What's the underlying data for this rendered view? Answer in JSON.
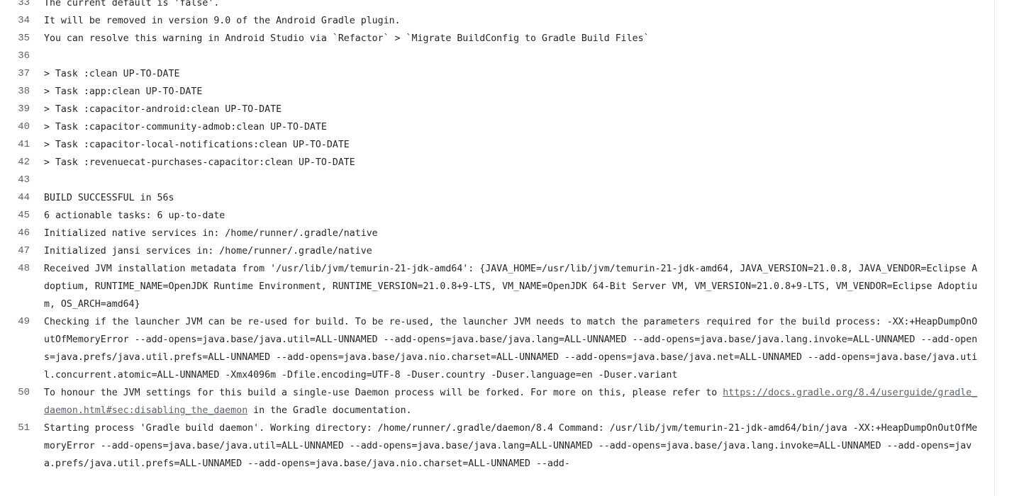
{
  "log": {
    "lines": [
      {
        "n": "33",
        "text": "The current default is 'false'."
      },
      {
        "n": "34",
        "text": "It will be removed in version 9.0 of the Android Gradle plugin."
      },
      {
        "n": "35",
        "text": "You can resolve this warning in Android Studio via `Refactor` > `Migrate BuildConfig to Gradle Build Files`"
      },
      {
        "n": "36",
        "text": ""
      },
      {
        "n": "37",
        "text": "> Task :clean UP-TO-DATE"
      },
      {
        "n": "38",
        "text": "> Task :app:clean UP-TO-DATE"
      },
      {
        "n": "39",
        "text": "> Task :capacitor-android:clean UP-TO-DATE"
      },
      {
        "n": "40",
        "text": "> Task :capacitor-community-admob:clean UP-TO-DATE"
      },
      {
        "n": "41",
        "text": "> Task :capacitor-local-notifications:clean UP-TO-DATE"
      },
      {
        "n": "42",
        "text": "> Task :revenuecat-purchases-capacitor:clean UP-TO-DATE"
      },
      {
        "n": "43",
        "text": ""
      },
      {
        "n": "44",
        "text": "BUILD SUCCESSFUL in 56s"
      },
      {
        "n": "45",
        "text": "6 actionable tasks: 6 up-to-date"
      },
      {
        "n": "46",
        "text": "Initialized native services in: /home/runner/.gradle/native"
      },
      {
        "n": "47",
        "text": "Initialized jansi services in: /home/runner/.gradle/native"
      },
      {
        "n": "48",
        "text": "Received JVM installation metadata from '/usr/lib/jvm/temurin-21-jdk-amd64': {JAVA_HOME=/usr/lib/jvm/temurin-21-jdk-amd64, JAVA_VERSION=21.0.8, JAVA_VENDOR=Eclipse Adoptium, RUNTIME_NAME=OpenJDK Runtime Environment, RUNTIME_VERSION=21.0.8+9-LTS, VM_NAME=OpenJDK 64-Bit Server VM, VM_VERSION=21.0.8+9-LTS, VM_VENDOR=Eclipse Adoptium, OS_ARCH=amd64}"
      },
      {
        "n": "49",
        "text": "Checking if the launcher JVM can be re-used for build. To be re-used, the launcher JVM needs to match the parameters required for the build process: -XX:+HeapDumpOnOutOfMemoryError --add-opens=java.base/java.util=ALL-UNNAMED --add-opens=java.base/java.lang=ALL-UNNAMED --add-opens=java.base/java.lang.invoke=ALL-UNNAMED --add-opens=java.prefs/java.util.prefs=ALL-UNNAMED --add-opens=java.base/java.nio.charset=ALL-UNNAMED --add-opens=java.base/java.net=ALL-UNNAMED --add-opens=java.base/java.util.concurrent.atomic=ALL-UNNAMED -Xmx4096m -Dfile.encoding=UTF-8 -Duser.country -Duser.language=en -Duser.variant"
      },
      {
        "n": "50",
        "text_before": "To honour the JVM settings for this build a single-use Daemon process will be forked. For more on this, please refer to ",
        "link": "https://docs.gradle.org/8.4/userguide/gradle_daemon.html#sec:disabling_the_daemon",
        "text_after": " in the Gradle documentation."
      },
      {
        "n": "51",
        "text": "Starting process 'Gradle build daemon'. Working directory: /home/runner/.gradle/daemon/8.4 Command: /usr/lib/jvm/temurin-21-jdk-amd64/bin/java -XX:+HeapDumpOnOutOfMemoryError --add-opens=java.base/java.util=ALL-UNNAMED --add-opens=java.base/java.lang=ALL-UNNAMED --add-opens=java.base/java.lang.invoke=ALL-UNNAMED --add-opens=java.prefs/java.util.prefs=ALL-UNNAMED --add-opens=java.base/java.nio.charset=ALL-UNNAMED --add-"
      }
    ]
  }
}
